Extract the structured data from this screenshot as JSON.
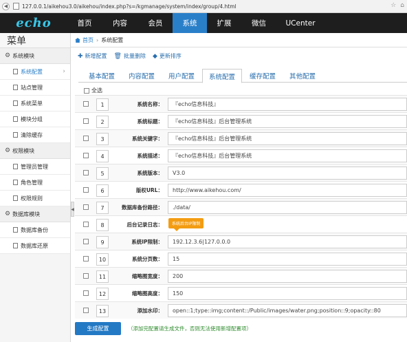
{
  "browser": {
    "url": "127.0.0.1/aikehou3.0/aikehou/index.php?s=/kgmanage/system/index/group/4.html"
  },
  "topnav": {
    "logo": "echo",
    "items": [
      {
        "label": "首页"
      },
      {
        "label": "内容"
      },
      {
        "label": "会员"
      },
      {
        "label": "系统"
      },
      {
        "label": "扩展"
      },
      {
        "label": "微信"
      },
      {
        "label": "UCenter"
      }
    ],
    "active_index": 3,
    "active_color": "#2a7fc9",
    "bg_color": "#1e1e1e"
  },
  "sidebar": {
    "title": "菜单",
    "groups": [
      {
        "label": "系统模块",
        "items": [
          {
            "label": "系统配置",
            "active": true
          },
          {
            "label": "站点管理"
          },
          {
            "label": "系统菜单"
          },
          {
            "label": "模块分组"
          },
          {
            "label": "清除缓存"
          }
        ]
      },
      {
        "label": "权限模块",
        "items": [
          {
            "label": "管理员管理"
          },
          {
            "label": "角色管理"
          },
          {
            "label": "权限规则"
          }
        ]
      },
      {
        "label": "数据库模块",
        "items": [
          {
            "label": "数据库备份"
          },
          {
            "label": "数据库还原"
          }
        ]
      }
    ]
  },
  "breadcrumb": {
    "home": "首页",
    "current": "系统配置"
  },
  "toolbar": {
    "add": "新增配置",
    "batch_delete": "批量删除",
    "update_sort": "更新排序"
  },
  "tabs": [
    {
      "label": "基本配置"
    },
    {
      "label": "内容配置"
    },
    {
      "label": "用户配置"
    },
    {
      "label": "系统配置",
      "active": true
    },
    {
      "label": "缓存配置"
    },
    {
      "label": "其他配置"
    }
  ],
  "select_all": "全选",
  "rows": [
    {
      "num": "1",
      "label": "系统名称：",
      "value": "『echo信息科技』"
    },
    {
      "num": "2",
      "label": "系统标题：",
      "value": "『echo信息科技』后台管理系统"
    },
    {
      "num": "3",
      "label": "系统关键字：",
      "value": "『echo信息科技』后台管理系统"
    },
    {
      "num": "4",
      "label": "系统描述：",
      "value": "『echo信息科技』后台管理系统"
    },
    {
      "num": "5",
      "label": "系统版本：",
      "value": "V3.0"
    },
    {
      "num": "6",
      "label": "版权URL：",
      "value": "http://www.aikehou.com/"
    },
    {
      "num": "7",
      "label": "数据库备份路径：",
      "value": "./data/"
    },
    {
      "num": "8",
      "label": "后台记录日志：",
      "value": "",
      "tooltip": "系统后台IP限制"
    },
    {
      "num": "9",
      "label": "系统IP限制：",
      "value": "192.12.3.6|127.0.0.0"
    },
    {
      "num": "10",
      "label": "系统分页数：",
      "value": "15"
    },
    {
      "num": "11",
      "label": "缩略图宽度：",
      "value": "200"
    },
    {
      "num": "12",
      "label": "缩略图高度：",
      "value": "150"
    },
    {
      "num": "13",
      "label": "添加水印：",
      "value": "open::1;type::img;content::/Public/images/water.png;position::9;opacity::80"
    }
  ],
  "footer": {
    "generate_button": "生成配置",
    "note": "（添加完配置请生成文件，否则无法使用新增配置项）"
  }
}
